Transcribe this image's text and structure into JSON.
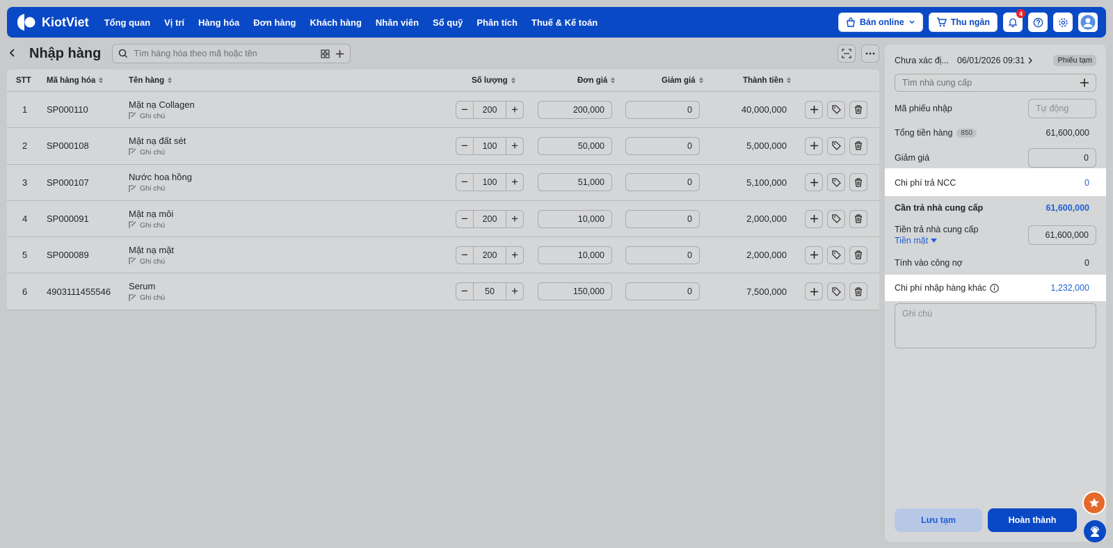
{
  "brand": {
    "name": "KiotViet"
  },
  "nav": [
    "Tổng quan",
    "Vị trí",
    "Hàng hóa",
    "Đơn hàng",
    "Khách hàng",
    "Nhân viên",
    "Sổ quỹ",
    "Phân tích",
    "Thuế & Kế toán"
  ],
  "topright": {
    "online_label": "Bán online",
    "cashier_label": "Thu ngân",
    "notif_count": "4"
  },
  "page": {
    "title": "Nhập hàng",
    "search_placeholder": "Tìm hàng hóa theo mã hoặc tên"
  },
  "table": {
    "headers": {
      "stt": "STT",
      "code": "Mã hàng hóa",
      "name": "Tên hàng",
      "qty": "Số lượng",
      "price": "Đơn giá",
      "discount": "Giảm giá",
      "total": "Thành tiền"
    },
    "note_label": "Ghi chú",
    "rows": [
      {
        "stt": "1",
        "code": "SP000110",
        "name": "Mặt nạ Collagen",
        "qty": "200",
        "price": "200,000",
        "discount": "0",
        "total": "40,000,000"
      },
      {
        "stt": "2",
        "code": "SP000108",
        "name": "Mặt nạ đất sét",
        "qty": "100",
        "price": "50,000",
        "discount": "0",
        "total": "5,000,000"
      },
      {
        "stt": "3",
        "code": "SP000107",
        "name": "Nước hoa hồng",
        "qty": "100",
        "price": "51,000",
        "discount": "0",
        "total": "5,100,000"
      },
      {
        "stt": "4",
        "code": "SP000091",
        "name": "Mặt nạ môi",
        "qty": "200",
        "price": "10,000",
        "discount": "0",
        "total": "2,000,000"
      },
      {
        "stt": "5",
        "code": "SP000089",
        "name": "Mặt nạ mặt",
        "qty": "200",
        "price": "10,000",
        "discount": "0",
        "total": "2,000,000"
      },
      {
        "stt": "6",
        "code": "4903111455546",
        "name": "Serum",
        "qty": "50",
        "price": "150,000",
        "discount": "0",
        "total": "7,500,000"
      }
    ]
  },
  "panel": {
    "branch": "Chưa xác đị...",
    "datetime": "06/01/2026 09:31",
    "status": "Phiếu tạm",
    "supplier_placeholder": "Tìm nhà cung cấp",
    "receipt_code_label": "Mã phiếu nhập",
    "receipt_code_placeholder": "Tự động",
    "total_goods_label": "Tổng tiền hàng",
    "total_goods_count": "850",
    "total_goods_value": "61,600,000",
    "discount_label": "Giảm giá",
    "discount_value": "0",
    "ncc_fee_label": "Chi phí trả NCC",
    "ncc_fee_value": "0",
    "need_pay_label": "Cần trả nhà cung cấp",
    "need_pay_value": "61,600,000",
    "paid_label": "Tiền trả nhà cung cấp",
    "paid_method": "Tiền mặt",
    "paid_value": "61,600,000",
    "debt_label": "Tính vào công nợ",
    "debt_value": "0",
    "other_cost_label": "Chi phí nhập hàng khác",
    "other_cost_value": "1,232,000",
    "note_placeholder": "Ghi chú",
    "save_label": "Lưu tạm",
    "done_label": "Hoàn thành"
  },
  "colors": {
    "primary": "#0a49c5",
    "accent_orange": "#e4692b",
    "link_blue": "#1f5fd6"
  }
}
